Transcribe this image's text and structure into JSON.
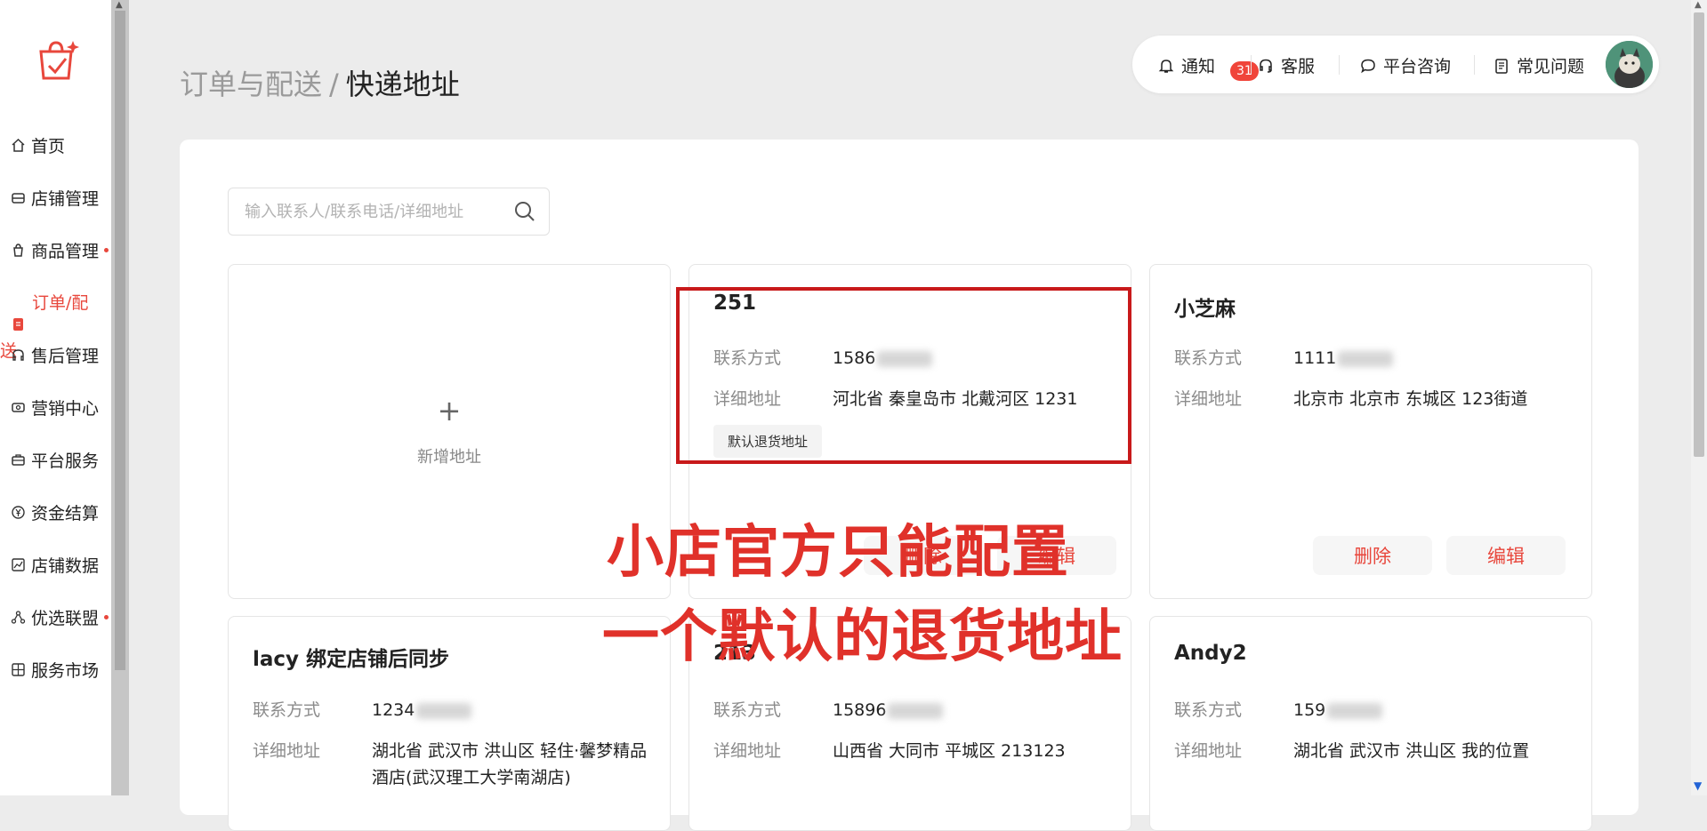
{
  "sidebar": {
    "items": [
      {
        "label": "首页",
        "icon": "home-icon"
      },
      {
        "label": "店铺管理",
        "icon": "store-icon"
      },
      {
        "label": "商品管理",
        "icon": "bag-icon",
        "dot": true
      },
      {
        "label": "售后管理",
        "icon": "headset-icon"
      },
      {
        "label": "营销中心",
        "icon": "coupon-icon"
      },
      {
        "label": "平台服务",
        "icon": "briefcase-icon"
      },
      {
        "label": "资金结算",
        "icon": "yuan-icon"
      },
      {
        "label": "店铺数据",
        "icon": "chart-icon"
      },
      {
        "label": "优选联盟",
        "icon": "network-icon",
        "dot": true
      },
      {
        "label": "服务市场",
        "icon": "grid-icon"
      }
    ],
    "active_label": "订单/配",
    "active_fragment": "送"
  },
  "breadcrumb": {
    "parent": "订单与配送",
    "separator": "/",
    "current": "快递地址"
  },
  "topbar": {
    "notify_label": "通知",
    "notify_count": "31",
    "service_label": "客服",
    "consult_label": "平台咨询",
    "faq_label": "常见问题"
  },
  "search": {
    "placeholder": "输入联系人/联系电话/详细地址",
    "value": ""
  },
  "add_card": {
    "label": "新增地址",
    "plus": "+"
  },
  "cards": [
    {
      "name": "251",
      "contact_label": "联系方式",
      "phone": "1586",
      "address_label": "详细地址",
      "address": "河北省 秦皇岛市 北戴河区 1231",
      "tag": "默认退货地址"
    },
    {
      "name": "小芝麻",
      "contact_label": "联系方式",
      "phone": "1111",
      "address_label": "详细地址",
      "address": "北京市 北京市 东城区 123街道",
      "delete_label": "删除",
      "edit_label": "编辑"
    },
    {
      "name": "lacy 绑定店铺后同步",
      "contact_label": "联系方式",
      "phone": "1234",
      "address_label": "详细地址",
      "address_line1": "湖北省 武汉市 洪山区 轻住·馨梦精品",
      "address_line2": "酒店(武汉理工大学南湖店)"
    },
    {
      "name": "213",
      "contact_label": "联系方式",
      "phone": "15896",
      "address_label": "详细地址",
      "address": "山西省 大同市 平城区 213123"
    },
    {
      "name": "Andy2",
      "contact_label": "联系方式",
      "phone": "159",
      "address_label": "详细地址",
      "address": "湖北省 武汉市 洪山区 我的位置"
    }
  ],
  "card1_buttons": {
    "delete_label": "删除",
    "edit_label": "编辑"
  },
  "annotation": {
    "line1": "小店官方只能配置",
    "line2": "一个默认的退货地址"
  },
  "colors": {
    "accent": "#e8473c",
    "annotation": "#e0312a",
    "highlight_border": "#c8191a"
  }
}
